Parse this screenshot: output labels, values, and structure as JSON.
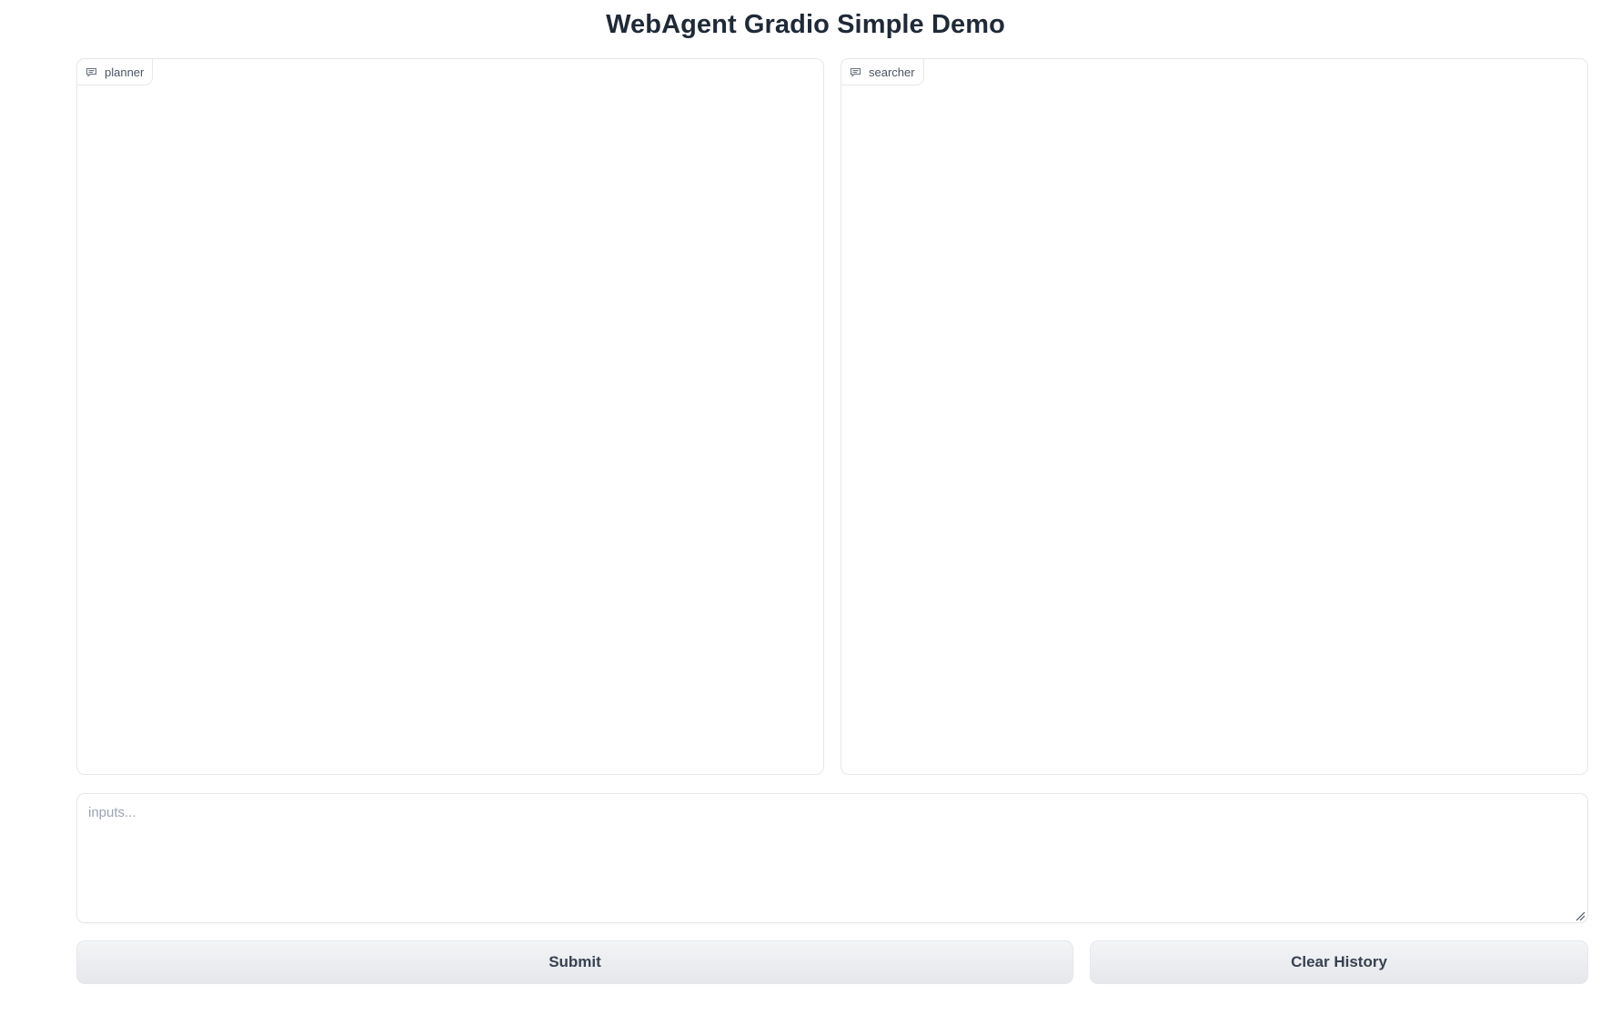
{
  "header": {
    "title": "WebAgent Gradio Simple Demo"
  },
  "chatbots": {
    "planner": {
      "label": "planner",
      "icon": "chat-bubble-icon"
    },
    "searcher": {
      "label": "searcher",
      "icon": "chat-bubble-icon"
    }
  },
  "input": {
    "placeholder": "inputs...",
    "value": ""
  },
  "buttons": {
    "submit_label": "Submit",
    "clear_label": "Clear History"
  },
  "colors": {
    "border": "#e5e7eb",
    "title_text": "#1f2937",
    "label_text": "#4b5563",
    "placeholder_text": "#9ca3af",
    "button_bg": "#e5e7eb"
  }
}
